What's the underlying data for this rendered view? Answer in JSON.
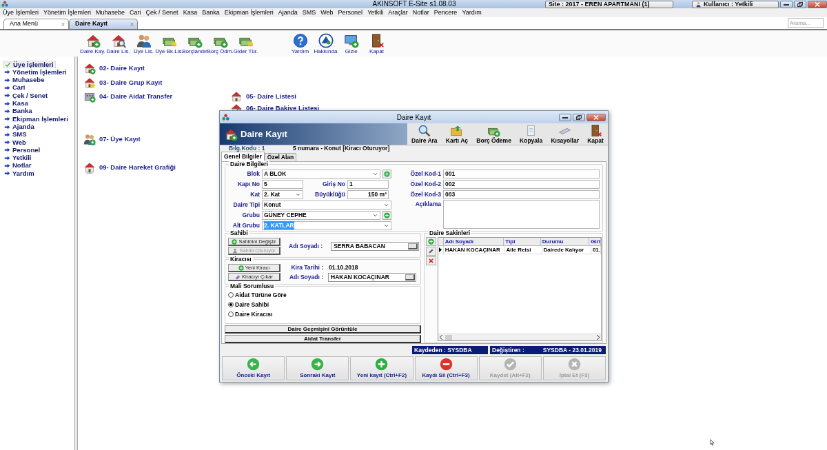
{
  "window": {
    "title": "AKINSOFT E-Site s1.08.03",
    "site": "Site : 2017 - EREN APARTMANI (1)",
    "user": "Kullanıcı : Yetkili"
  },
  "menu": [
    "Üye İşlemleri",
    "Yönetim İşlemleri",
    "Muhasebe",
    "Cari",
    "Çek / Senet",
    "Kasa",
    "Banka",
    "Ekipman İşlemleri",
    "Ajanda",
    "SMS",
    "Web",
    "Personel",
    "Yetkili",
    "Araçlar",
    "Notlar",
    "Pencere",
    "Yardım"
  ],
  "tabs": [
    {
      "label": "Ana Menü",
      "selected": false
    },
    {
      "label": "Daire Kayıt",
      "selected": true
    }
  ],
  "search": {
    "placeholder": "Arama..."
  },
  "toolbar": {
    "groups": [
      [
        {
          "label": "Daire Kay.",
          "kind": "house-add"
        },
        {
          "label": "Daire Lis.",
          "kind": "house-search"
        },
        {
          "label": "Üye Lis.",
          "kind": "people"
        },
        {
          "label": "Üye Bk.Lis.",
          "kind": "money-list"
        },
        {
          "label": "Borçlandır",
          "kind": "money-add"
        },
        {
          "label": "Borç Ödm.",
          "kind": "money-pay"
        },
        {
          "label": "Gider Tür.",
          "kind": "money-coins"
        }
      ],
      [
        {
          "label": "Yardım",
          "kind": "help"
        },
        {
          "label": "Hakkında",
          "kind": "logo"
        },
        {
          "label": "Gizle",
          "kind": "monitor"
        },
        {
          "label": "Kapat",
          "kind": "door"
        }
      ]
    ]
  },
  "sidebar": {
    "items": [
      {
        "label": "Üye İşlemleri",
        "selected": true
      },
      {
        "label": "Yönetim İşlemleri",
        "selected": false
      },
      {
        "label": "Muhasebe",
        "selected": false
      },
      {
        "label": "Cari",
        "selected": false
      },
      {
        "label": "Çek / Senet",
        "selected": false
      },
      {
        "label": "Kasa",
        "selected": false
      },
      {
        "label": "Banka",
        "selected": false
      },
      {
        "label": "Ekipman İşlemleri",
        "selected": false
      },
      {
        "label": "Ajanda",
        "selected": false
      },
      {
        "label": "SMS",
        "selected": false
      },
      {
        "label": "Web",
        "selected": false
      },
      {
        "label": "Personel",
        "selected": false
      },
      {
        "label": "Yetkili",
        "selected": false
      },
      {
        "label": "Notlar",
        "selected": false
      },
      {
        "label": "Yardım",
        "selected": false
      }
    ]
  },
  "shortcuts": {
    "column_1": [
      {
        "label": "02- Daire Kayıt",
        "kind": "house-add"
      },
      {
        "label": "03- Daire Grup Kayıt",
        "kind": "house-star"
      },
      {
        "label": "04- Daire Aidat Transfer",
        "kind": "building"
      },
      {
        "label": "07- Üye Kayıt",
        "kind": "people-add"
      },
      {
        "label": "09- Daire Hareket Grafiği",
        "kind": "house-chart"
      }
    ],
    "column_2": [
      {
        "label": "05- Daire Listesi",
        "kind": "house"
      },
      {
        "label": "06- Daire Bakiye Listesi",
        "kind": "house-search"
      }
    ]
  },
  "dialog": {
    "title": "Daire Kayıt",
    "header": "Daire Kayıt",
    "actions": [
      {
        "label": "Daire Ara",
        "kind": "search"
      },
      {
        "label": "Kartı Aç",
        "kind": "folder"
      },
      {
        "label": "Borç Ödeme",
        "kind": "money-pay"
      },
      {
        "label": "Kopyala",
        "kind": "document"
      },
      {
        "label": "Kısayollar",
        "kind": "keyboard"
      },
      {
        "label": "Kapat",
        "kind": "door"
      }
    ],
    "code": "Bilg.Kodu : 1",
    "summary": "5 numara - Konut [Kiracı Oturuyor]",
    "tabs": [
      {
        "label": "Genel Bilgiler",
        "selected": true
      },
      {
        "label": "Özel Alan",
        "selected": false
      }
    ],
    "daire_bilgileri": {
      "title": "Daire Bilgileri",
      "rows": [
        [
          {
            "label": "Blok",
            "value": "A BLOK",
            "kind": "select-add",
            "focused": false
          }
        ],
        [
          {
            "label": "Kapı No",
            "value": "5",
            "kind": "text",
            "focused": false
          },
          {
            "label": "Giriş No",
            "value": "1",
            "kind": "text",
            "focused": false
          }
        ],
        [
          {
            "label": "Kat",
            "value": "2. Kat",
            "kind": "select",
            "focused": false
          },
          {
            "label": "Büyüklüğü",
            "value": "150 m²",
            "kind": "number",
            "focused": false
          }
        ],
        [
          {
            "label": "Daire Tipi",
            "value": "Konut",
            "kind": "select",
            "focused": false
          }
        ],
        [
          {
            "label": "Grubu",
            "value": "GÜNEY CEPHE",
            "kind": "select-add",
            "focused": false
          }
        ],
        [
          {
            "label": "Alt Grubu",
            "value": "2. KATLAR",
            "kind": "select",
            "focused": true
          }
        ]
      ],
      "fields": [
        {
          "label": "Özel Kod-1",
          "value": "001",
          "kind": "text",
          "focused": false
        },
        {
          "label": "Özel Kod-2",
          "value": "002",
          "kind": "text",
          "focused": false
        },
        {
          "label": "Özel Kod-3",
          "value": "003",
          "kind": "text",
          "focused": false
        },
        {
          "label": "Açıklama",
          "kind": "textarea",
          "focused": false
        }
      ]
    },
    "sahibi": {
      "title": "Sahibi",
      "buttons": [
        {
          "label": "Sahibini Değiştir",
          "kind": "add",
          "disabled": false
        },
        {
          "label": "Sahibi Oturuyor",
          "kind": "person",
          "disabled": true
        }
      ],
      "name_label": "Adı Soyadı :",
      "name_value": "SERRA BABACAN"
    },
    "kiracisi": {
      "title": "Kiracısı",
      "buttons": [
        {
          "label": "Yeni Kiracı",
          "kind": "add",
          "disabled": false
        },
        {
          "label": "Kiracıyı Çıkar",
          "kind": "eraser",
          "disabled": false
        }
      ],
      "date_label": "Kira Tarihi :",
      "date_value": "01.10.2018",
      "name_label": "Adı Soyadı :",
      "name_value": "HAKAN KOCAÇINAR"
    },
    "mali_sorumlusu": {
      "title": "Mali Sorumlusu",
      "options": [
        {
          "label": "Aidat Türüne Göre",
          "selected": false
        },
        {
          "label": "Daire Sahibi",
          "selected": true
        },
        {
          "label": "Daire Kiracısı",
          "selected": false
        }
      ]
    },
    "wide_buttons": [
      "Daire Geçmişini Görüntüle",
      "Aidat Transfer"
    ],
    "sakinler": {
      "title": "Daire Sakinleri",
      "tools": [
        {
          "kind": "add"
        },
        {
          "kind": "edit"
        },
        {
          "kind": "delete"
        }
      ],
      "columns": [
        "Adı Soyadı",
        "Tipi",
        "Durumu",
        "Giri"
      ],
      "rows": [
        {
          "selected": true,
          "cells": [
            "HAKAN KOCAÇINAR",
            "Aile Reisi",
            "Dairede Kalıyor",
            "01."
          ]
        }
      ]
    },
    "status": {
      "created": "Kaydeden : SYSDBA",
      "modified_label": "Değiştiren :",
      "modified_value": "SYSDBA - 23.01.2019"
    },
    "footer": [
      {
        "label": "Önceki Kayıt",
        "kind": "back",
        "disabled": false
      },
      {
        "label": "Sonraki Kayıt",
        "kind": "forward",
        "disabled": false
      },
      {
        "label": "Yeni kayıt (Ctrl+F2)",
        "kind": "add",
        "disabled": false
      },
      {
        "label": "Kaydı Sil (Ctrl+F3)",
        "kind": "remove",
        "disabled": false
      },
      {
        "label": "Kaydet (Alt+F2)",
        "kind": "check",
        "disabled": true
      },
      {
        "label": "İptal Et (F3)",
        "kind": "cancel",
        "disabled": true
      }
    ]
  }
}
